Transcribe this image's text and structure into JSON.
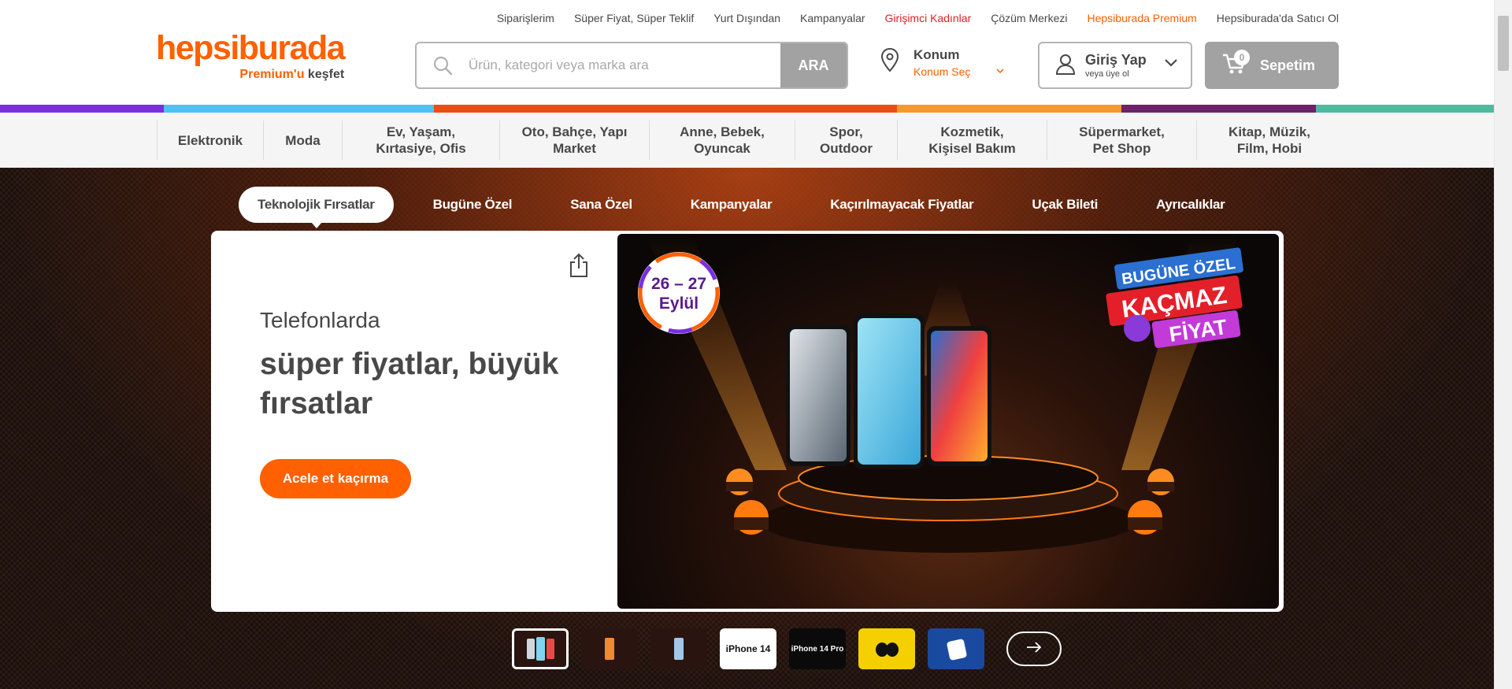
{
  "top_links": [
    {
      "label": "Siparişlerim"
    },
    {
      "label": "Süper Fiyat, Süper Teklif"
    },
    {
      "label": "Yurt Dışından"
    },
    {
      "label": "Kampanyalar"
    },
    {
      "label": "Girişimci Kadınlar"
    },
    {
      "label": "Çözüm Merkezi"
    },
    {
      "label": "Hepsiburada Premium"
    },
    {
      "label": "Hepsiburada'da Satıcı Ol"
    }
  ],
  "logo": {
    "brand": "hepsiburada",
    "tag_prefix": "Premium'u",
    "tag_suffix": "keşfet"
  },
  "search": {
    "placeholder": "Ürün, kategori veya marka ara",
    "value": "",
    "button_label": "ARA"
  },
  "location": {
    "title": "Konum",
    "subtitle": "Konum Seç"
  },
  "account": {
    "title": "Giriş Yap",
    "subtitle": "veya üye ol"
  },
  "cart": {
    "label": "Sepetim",
    "count": "0"
  },
  "colors": {
    "brand_orange": "#ff6000",
    "stripe": [
      "#7b2ee0",
      "#4cc3ee",
      "#ec4d17",
      "#f39b28",
      "#6c2369",
      "#50b99e"
    ]
  },
  "categories": [
    {
      "line1": "Elektronik",
      "line2": ""
    },
    {
      "line1": "Moda",
      "line2": ""
    },
    {
      "line1": "Ev, Yaşam,",
      "line2": "Kırtasiye, Ofis"
    },
    {
      "line1": "Oto, Bahçe, Yapı",
      "line2": "Market"
    },
    {
      "line1": "Anne, Bebek,",
      "line2": "Oyuncak"
    },
    {
      "line1": "Spor,",
      "line2": "Outdoor"
    },
    {
      "line1": "Kozmetik,",
      "line2": "Kişisel Bakım"
    },
    {
      "line1": "Süpermarket,",
      "line2": "Pet Shop"
    },
    {
      "line1": "Kitap, Müzik,",
      "line2": "Film, Hobi"
    }
  ],
  "hero_tabs": [
    {
      "label": "Teknolojik Fırsatlar"
    },
    {
      "label": "Bugüne Özel"
    },
    {
      "label": "Sana Özel"
    },
    {
      "label": "Kampanyalar"
    },
    {
      "label": "Kaçırılmayacak Fiyatlar"
    },
    {
      "label": "Uçak Bileti"
    },
    {
      "label": "Ayrıcalıklar"
    }
  ],
  "hero": {
    "subtitle": "Telefonlarda",
    "title": "süper fiyatlar, büyük fırsatlar",
    "cta_label": "Acele et kaçırma",
    "banner": {
      "date_line1": "26 – 27",
      "date_line2": "Eylül",
      "badge_line1": "BUGÜNE ÖZEL",
      "badge_line2": "KAÇMAZ",
      "badge_line3": "FİYAT"
    }
  },
  "thumbnails": [
    {
      "label": ""
    },
    {
      "label": ""
    },
    {
      "label": ""
    },
    {
      "label": "iPhone 14"
    },
    {
      "label": "iPhone 14 Pro"
    },
    {
      "label": ""
    },
    {
      "label": ""
    }
  ],
  "icons": [
    "search-icon",
    "location-pin-icon",
    "chevron-down-icon",
    "user-icon",
    "cart-icon",
    "share-icon",
    "arrow-right-icon"
  ]
}
